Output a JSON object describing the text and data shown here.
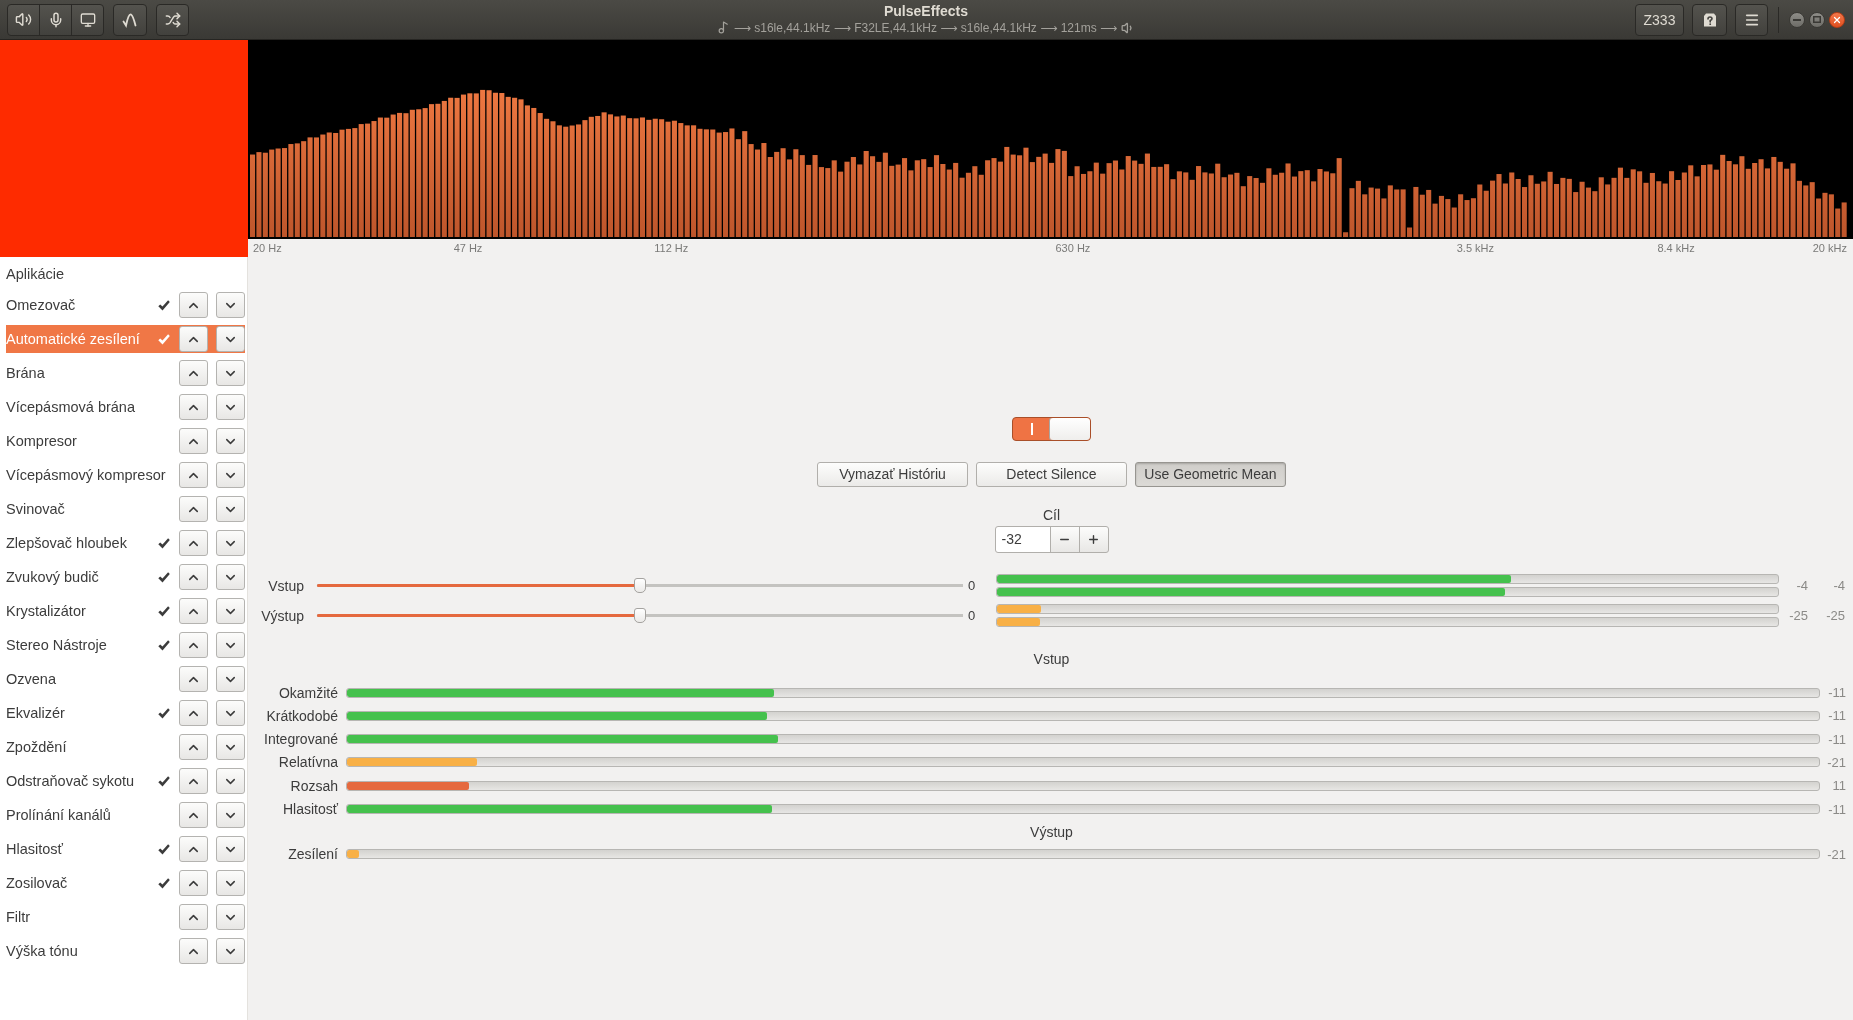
{
  "header": {
    "title": "PulseEffects",
    "pipeline": "⟶ s16le,44.1kHz ⟶ F32LE,44.1kHz ⟶ s16le,44.1kHz ⟶ 121ms ⟶",
    "preset_button": "Z333"
  },
  "spectrum": {
    "axis_labels": [
      "20 Hz",
      "47 Hz",
      "112 Hz",
      "630 Hz",
      "3.5 kHz",
      "8.4 kHz",
      "20 kHz"
    ]
  },
  "sidebar": {
    "items": [
      {
        "kind": "apps",
        "label": "Aplikácie",
        "selected": false
      },
      {
        "kind": "plugin",
        "label": "Omezovač",
        "enabled": true,
        "selected": false
      },
      {
        "kind": "plugin",
        "label": "Automatické zesílení",
        "enabled": true,
        "selected": true
      },
      {
        "kind": "plugin",
        "label": "Brána",
        "enabled": false,
        "selected": false
      },
      {
        "kind": "plugin",
        "label": "Vícepásmová brána",
        "enabled": false,
        "selected": false
      },
      {
        "kind": "plugin",
        "label": "Kompresor",
        "enabled": false,
        "selected": false
      },
      {
        "kind": "plugin",
        "label": "Vícepásmový kompresor",
        "enabled": false,
        "selected": false
      },
      {
        "kind": "plugin",
        "label": "Svinovač",
        "enabled": false,
        "selected": false
      },
      {
        "kind": "plugin",
        "label": "Zlepšovač hloubek",
        "enabled": true,
        "selected": false
      },
      {
        "kind": "plugin",
        "label": "Zvukový budič",
        "enabled": true,
        "selected": false
      },
      {
        "kind": "plugin",
        "label": "Krystalizátor",
        "enabled": true,
        "selected": false
      },
      {
        "kind": "plugin",
        "label": "Stereo Nástroje",
        "enabled": true,
        "selected": false
      },
      {
        "kind": "plugin",
        "label": "Ozvena",
        "enabled": false,
        "selected": false
      },
      {
        "kind": "plugin",
        "label": "Ekvalizér",
        "enabled": true,
        "selected": false
      },
      {
        "kind": "plugin",
        "label": "Zpoždění",
        "enabled": false,
        "selected": false
      },
      {
        "kind": "plugin",
        "label": "Odstraňovač sykotu",
        "enabled": true,
        "selected": false
      },
      {
        "kind": "plugin",
        "label": "Prolínání kanálů",
        "enabled": false,
        "selected": false
      },
      {
        "kind": "plugin",
        "label": "Hlasitosť",
        "enabled": true,
        "selected": false
      },
      {
        "kind": "plugin",
        "label": "Zosilovač",
        "enabled": true,
        "selected": false
      },
      {
        "kind": "plugin",
        "label": "Filtr",
        "enabled": false,
        "selected": false
      },
      {
        "kind": "plugin",
        "label": "Výška tónu",
        "enabled": false,
        "selected": false
      }
    ]
  },
  "controls": {
    "switch": {
      "on": true
    },
    "buttons": [
      {
        "label": "Vymazať Históriu",
        "pressed": false
      },
      {
        "label": "Detect Silence",
        "pressed": false
      },
      {
        "label": "Use Geometric Mean",
        "pressed": true
      }
    ],
    "target": {
      "label": "Cíl",
      "value": "-32"
    },
    "gain_rows": [
      {
        "label": "Vstup",
        "level": 0.5,
        "value": "0",
        "meters": [
          {
            "level": 0.658,
            "color": "#45c14d"
          },
          {
            "level": 0.65,
            "color": "#45c14d"
          }
        ],
        "readings": [
          "-4",
          "-4"
        ]
      },
      {
        "label": "Výstup",
        "level": 0.5,
        "value": "0",
        "meters": [
          {
            "level": 0.056,
            "color": "#f8b046"
          },
          {
            "level": 0.055,
            "color": "#f8b046"
          }
        ],
        "readings": [
          "-25",
          "-25"
        ]
      }
    ]
  },
  "loudness": {
    "sections": [
      {
        "title": "Vstup",
        "rows": [
          {
            "label": "Okamžité",
            "level": 0.29,
            "color": "#45c14d",
            "reading": "-11"
          },
          {
            "label": "Krátkodobé",
            "level": 0.285,
            "color": "#45c14d",
            "reading": "-11"
          },
          {
            "label": "Integrované",
            "level": 0.293,
            "color": "#45c14d",
            "reading": "-11"
          },
          {
            "label": "Relatívna",
            "level": 0.088,
            "color": "#f8b046",
            "reading": "-21"
          },
          {
            "label": "Rozsah",
            "level": 0.083,
            "color": "#e5693e",
            "reading": "11"
          },
          {
            "label": "Hlasitosť",
            "level": 0.289,
            "color": "#45c14d",
            "reading": "-11"
          }
        ]
      },
      {
        "title": "Výstup",
        "rows": [
          {
            "label": "Zesílení",
            "level": 0.008,
            "color": "#f8b046",
            "reading": "-21"
          }
        ]
      }
    ]
  }
}
